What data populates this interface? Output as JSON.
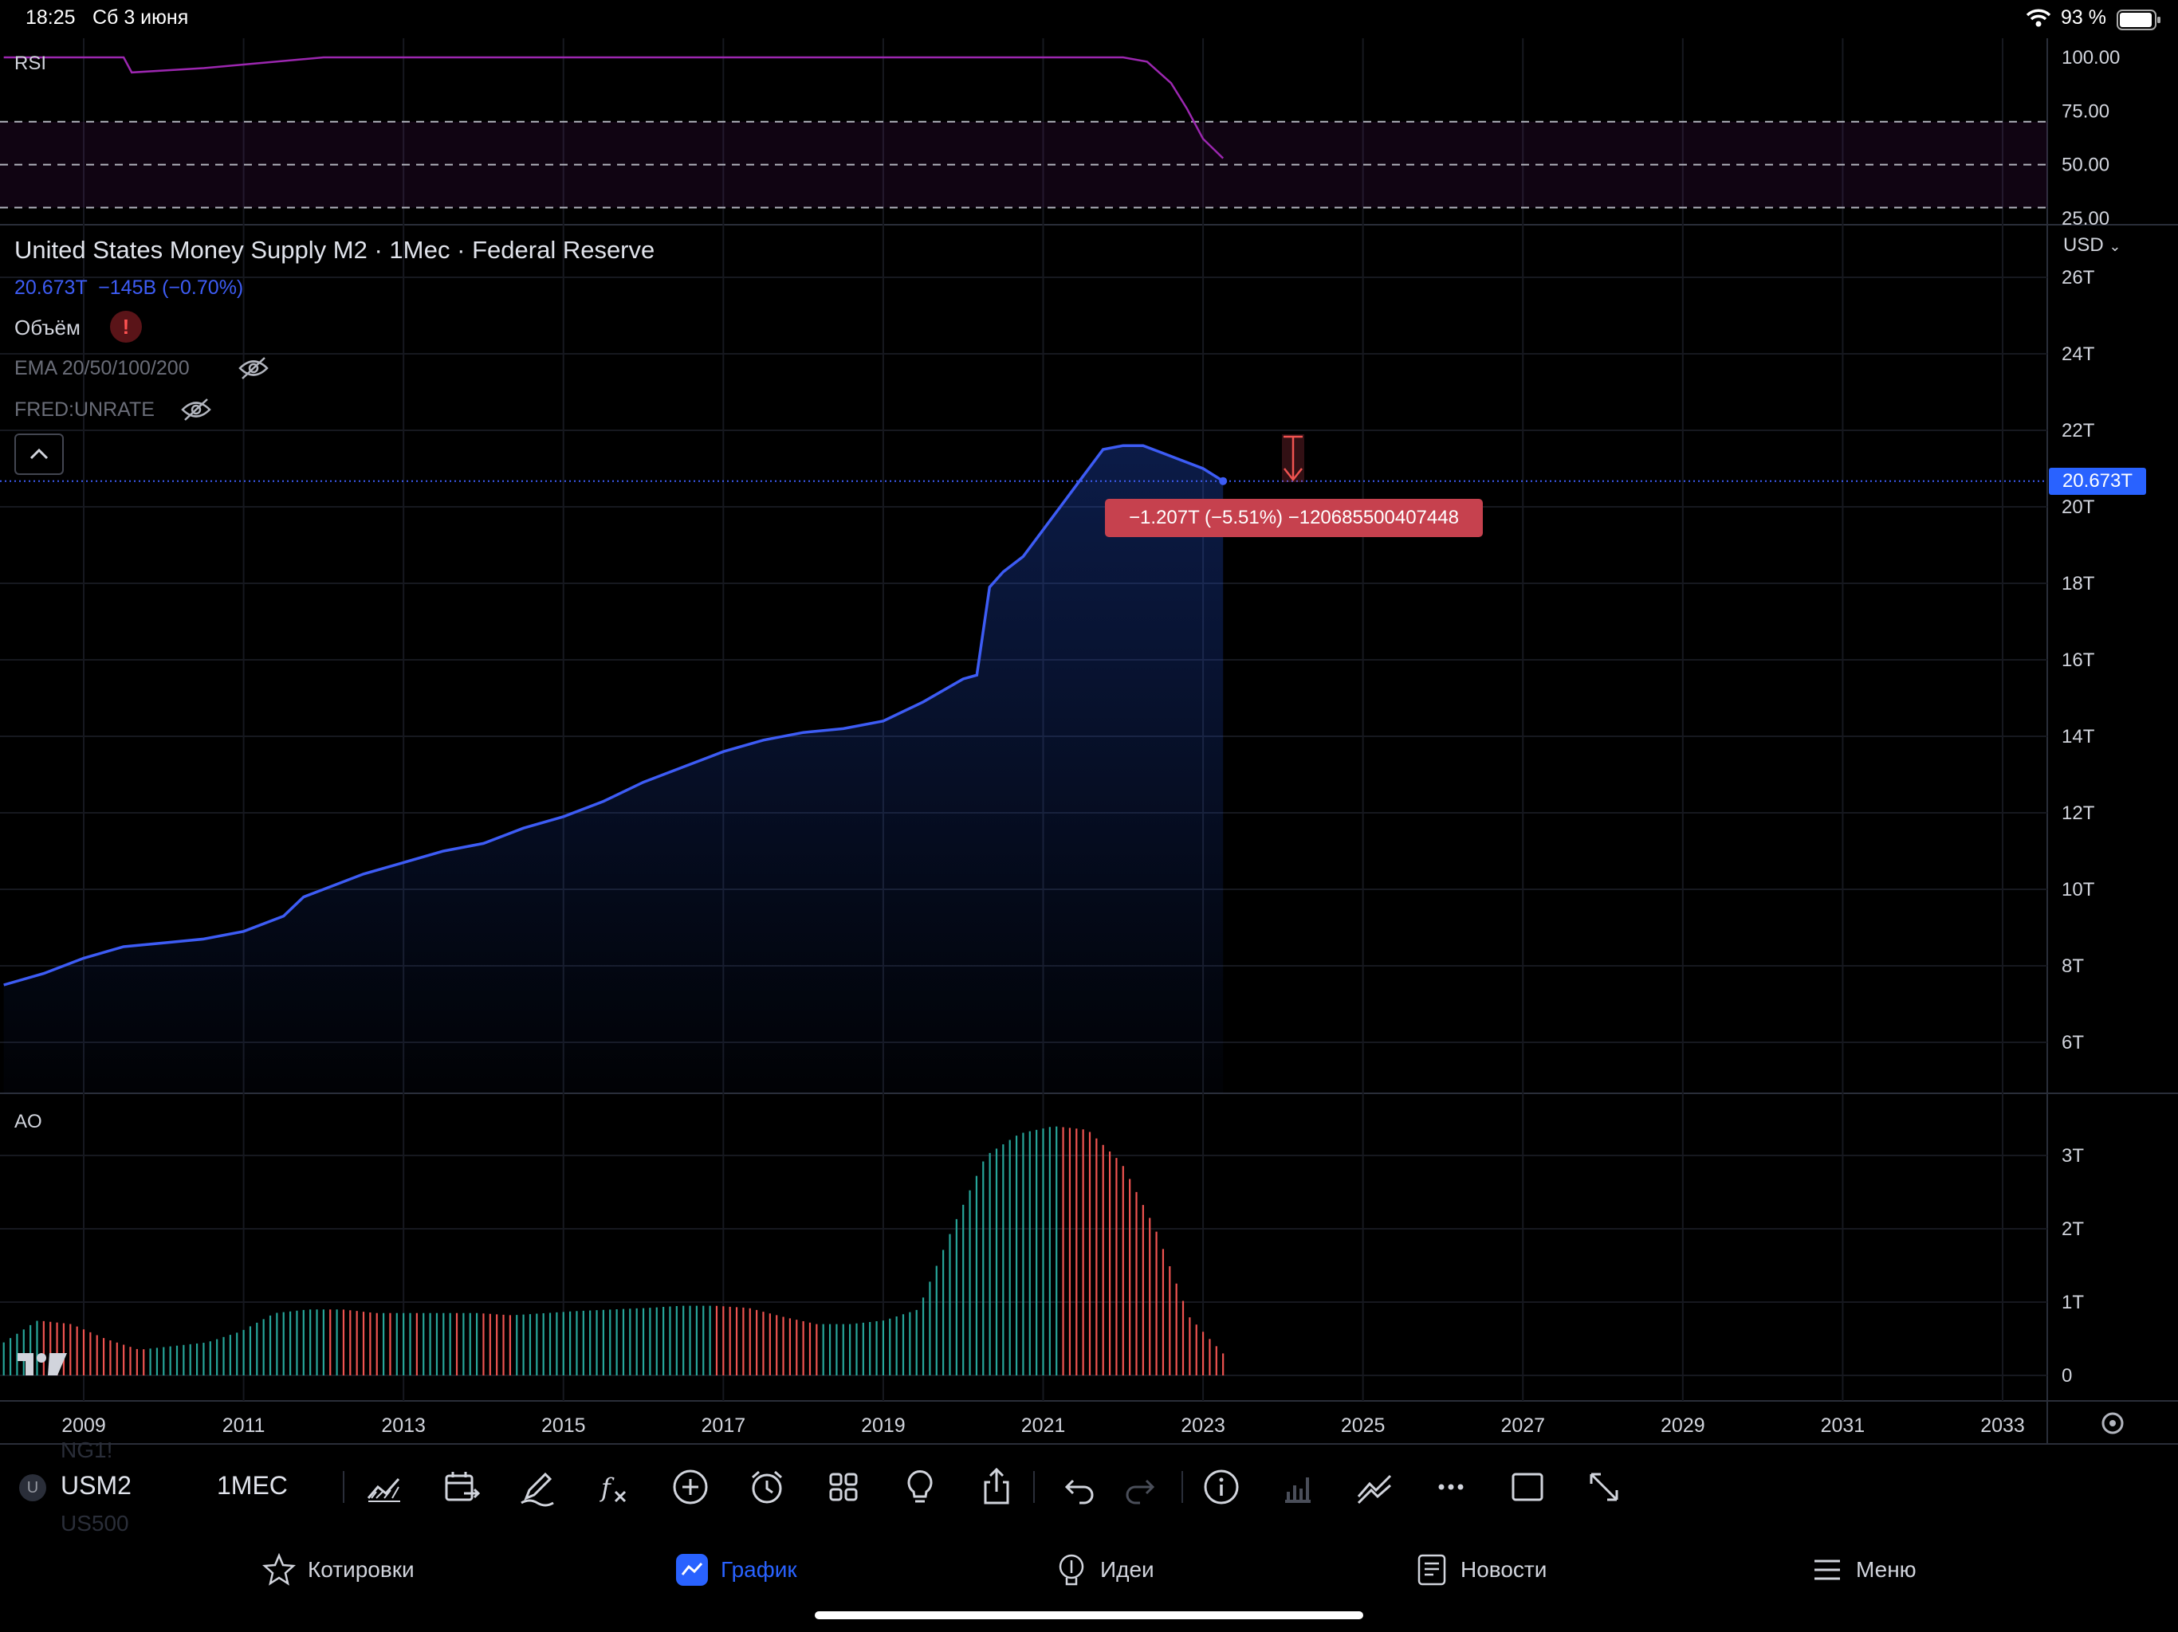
{
  "status_bar": {
    "time": "18:25",
    "date": "Сб 3 июня",
    "battery": "93 %",
    "icons": [
      "wifi-icon",
      "battery-icon"
    ]
  },
  "rsi": {
    "label": "RSI",
    "ticks": [
      "100.00",
      "75.00",
      "50.00",
      "25.00"
    ],
    "line_color": "#9c27b0"
  },
  "header": {
    "title": "United States Money Supply M2 · 1Мес · Federal Reserve",
    "price_line": "20.673T  −145B (−0.70%)",
    "volume_label": "Объём",
    "ema_label": "EMA 20/50/100/200",
    "unrate_label": "FRED:UNRATE",
    "currency": "USD"
  },
  "price_axis": {
    "ticks": [
      "26T",
      "24T",
      "22T",
      "20T",
      "18T",
      "16T",
      "14T",
      "12T",
      "10T",
      "8T",
      "6T"
    ],
    "last_price": "20.673T"
  },
  "measure": {
    "label": "−1.207T (−5.51%) −120685500407448"
  },
  "ao": {
    "label": "AO",
    "ticks": [
      "3T",
      "2T",
      "1T",
      "0"
    ]
  },
  "time_axis": {
    "ticks": [
      "2009",
      "2011",
      "2013",
      "2015",
      "2017",
      "2019",
      "2021",
      "2023",
      "2025",
      "2027",
      "2029",
      "2031",
      "2033"
    ]
  },
  "toolbar": {
    "symbol_badge": "U",
    "symbol": "USM2",
    "interval": "1МЕС",
    "ghost_above": "NG1!",
    "ghost_below": "US500",
    "icons": [
      "chart-type-icon",
      "compare-icon",
      "draw-icon",
      "indicators-icon",
      "add-icon",
      "alert-icon",
      "layouts-icon",
      "ideas-icon",
      "share-icon",
      "undo-icon",
      "redo-icon",
      "info-icon",
      "volume-icon",
      "trend-icon",
      "more-icon",
      "fullscreen-box-icon",
      "expand-icon"
    ]
  },
  "bottom_nav": {
    "items": [
      {
        "label": "Котировки",
        "icon": "star-icon"
      },
      {
        "label": "График",
        "icon": "chart-icon"
      },
      {
        "label": "Идеи",
        "icon": "lightbulb-icon"
      },
      {
        "label": "Новости",
        "icon": "news-icon"
      },
      {
        "label": "Меню",
        "icon": "menu-icon"
      }
    ],
    "active": "График"
  },
  "colors": {
    "accent": "#2962ff",
    "line": "#3d5cf5",
    "up": "#26a69a",
    "down": "#ef5350",
    "measure": "#c6414e"
  },
  "chart_data": [
    {
      "type": "line",
      "title": "United States Money Supply M2 · 1Мес · Federal Reserve",
      "ylabel": "USD",
      "ylim": [
        5,
        26.5
      ],
      "xlim": [
        2008.0,
        2034.0
      ],
      "x": [
        2008.0,
        2008.5,
        2009.0,
        2009.5,
        2010.0,
        2010.5,
        2011.0,
        2011.5,
        2011.75,
        2012.0,
        2012.5,
        2013.0,
        2013.5,
        2014.0,
        2014.5,
        2015.0,
        2015.5,
        2016.0,
        2016.5,
        2017.0,
        2017.5,
        2018.0,
        2018.5,
        2019.0,
        2019.5,
        2020.0,
        2020.17,
        2020.33,
        2020.5,
        2020.75,
        2021.0,
        2021.25,
        2021.5,
        2021.75,
        2022.0,
        2022.25,
        2022.5,
        2022.75,
        2023.0,
        2023.25
      ],
      "values": [
        7.5,
        7.8,
        8.2,
        8.5,
        8.6,
        8.7,
        8.9,
        9.3,
        9.8,
        10.0,
        10.4,
        10.7,
        11.0,
        11.2,
        11.6,
        11.9,
        12.3,
        12.8,
        13.2,
        13.6,
        13.9,
        14.1,
        14.2,
        14.4,
        14.9,
        15.5,
        15.6,
        17.9,
        18.3,
        18.7,
        19.4,
        20.1,
        20.8,
        21.5,
        21.6,
        21.6,
        21.4,
        21.2,
        21.0,
        20.673
      ],
      "last_value": 20.673,
      "series": [
        {
          "name": "USM2"
        }
      ]
    },
    {
      "type": "bar",
      "title": "AO",
      "ylim": [
        0,
        3.8
      ],
      "x_start": 2008.0,
      "x_end": 2023.25,
      "points_per_year": 12,
      "values": [
        0.45,
        0.75,
        0.7,
        0.5,
        0.35,
        0.4,
        0.45,
        0.6,
        0.85,
        0.9,
        0.9,
        0.85,
        0.85,
        0.85,
        0.85,
        0.82,
        0.85,
        0.88,
        0.9,
        0.92,
        0.95,
        0.95,
        0.92,
        0.8,
        0.7,
        0.7,
        0.75,
        0.9,
        2.0,
        3.0,
        3.3,
        3.4,
        3.35,
        2.9,
        2.0,
        0.8,
        0.3
      ],
      "colors": {
        "up": "#26a69a",
        "down": "#ef5350"
      }
    },
    {
      "type": "line",
      "title": "RSI",
      "ylim": [
        25,
        100
      ],
      "levels": [
        70,
        50,
        30
      ],
      "x": [
        2008.0,
        2009.5,
        2009.6,
        2010.5,
        2012.0,
        2020.0,
        2021.0,
        2021.5,
        2022.0,
        2022.3,
        2022.6,
        2022.8,
        2023.0,
        2023.25
      ],
      "values": [
        100,
        100,
        93,
        95,
        100,
        100,
        100,
        100,
        100,
        98,
        88,
        76,
        62,
        53
      ]
    }
  ]
}
